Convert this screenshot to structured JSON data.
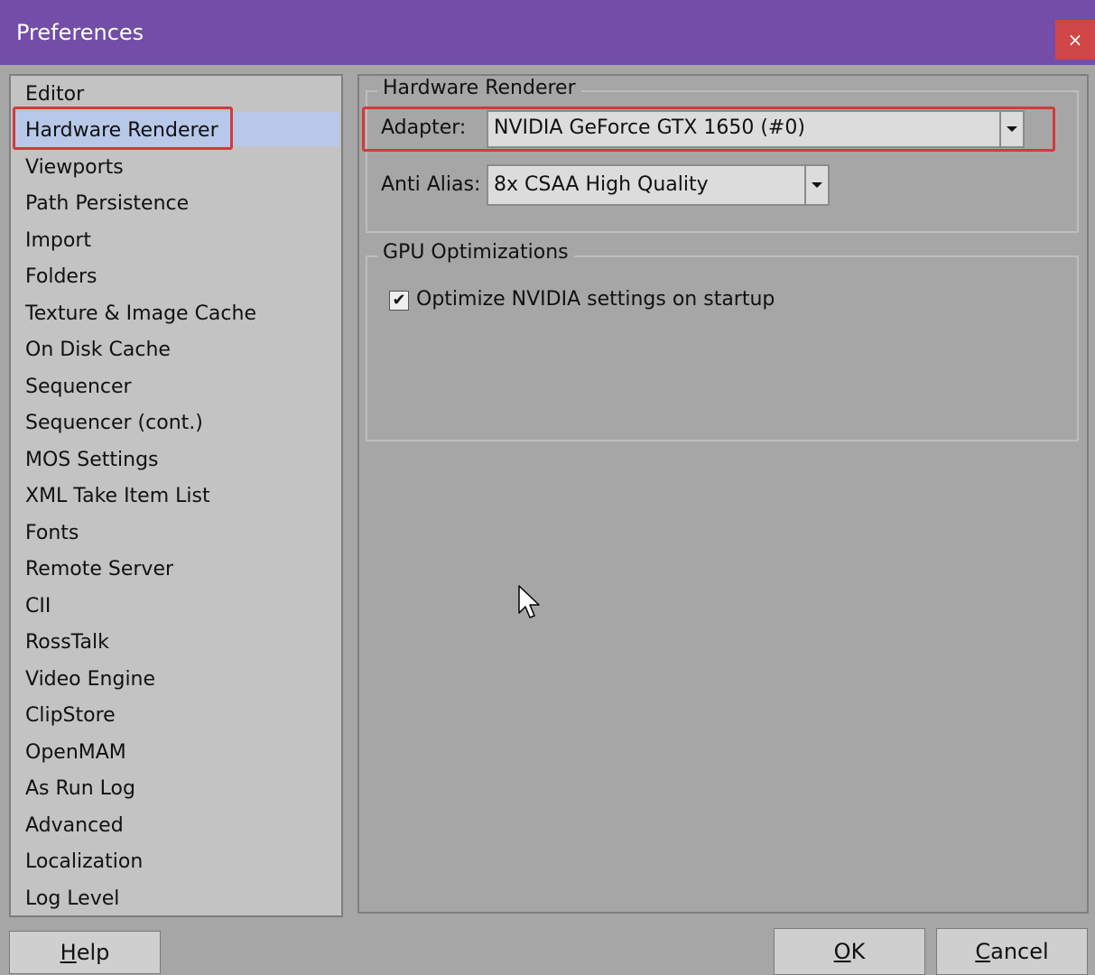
{
  "window": {
    "title": "Preferences",
    "close_symbol": "×"
  },
  "sidebar": {
    "items": [
      {
        "label": "Editor"
      },
      {
        "label": "Hardware Renderer"
      },
      {
        "label": "Viewports"
      },
      {
        "label": "Path Persistence"
      },
      {
        "label": "Import"
      },
      {
        "label": "Folders"
      },
      {
        "label": "Texture & Image Cache"
      },
      {
        "label": "On Disk Cache"
      },
      {
        "label": "Sequencer"
      },
      {
        "label": "Sequencer (cont.)"
      },
      {
        "label": "MOS Settings"
      },
      {
        "label": "XML Take Item List"
      },
      {
        "label": "Fonts"
      },
      {
        "label": "Remote Server"
      },
      {
        "label": "CII"
      },
      {
        "label": "RossTalk"
      },
      {
        "label": "Video Engine"
      },
      {
        "label": "ClipStore"
      },
      {
        "label": "OpenMAM"
      },
      {
        "label": "As Run Log"
      },
      {
        "label": "Advanced"
      },
      {
        "label": "Localization"
      },
      {
        "label": "Log Level"
      }
    ],
    "selected": "Hardware Renderer"
  },
  "hardware_renderer": {
    "group_title": "Hardware Renderer",
    "adapter_label": "Adapter:",
    "adapter_value": "NVIDIA GeForce GTX 1650 (#0)",
    "anti_alias_label": "Anti Alias:",
    "anti_alias_value": "8x CSAA High Quality"
  },
  "gpu_optimizations": {
    "group_title": "GPU Optimizations",
    "optimize_label": "Optimize NVIDIA settings on startup",
    "optimize_checked": true,
    "check_symbol": "✔"
  },
  "buttons": {
    "help_first": "H",
    "help_rest": "elp",
    "ok_first": "O",
    "ok_rest": "K",
    "cancel_first": "C",
    "cancel_rest": "ancel"
  },
  "colors": {
    "titlebar": "#744da9",
    "highlight": "#d23a3a",
    "selection": "#b8c8e8"
  },
  "icons": [
    "close-icon",
    "chevron-down-icon",
    "checkmark-icon",
    "mouse-cursor-icon"
  ]
}
